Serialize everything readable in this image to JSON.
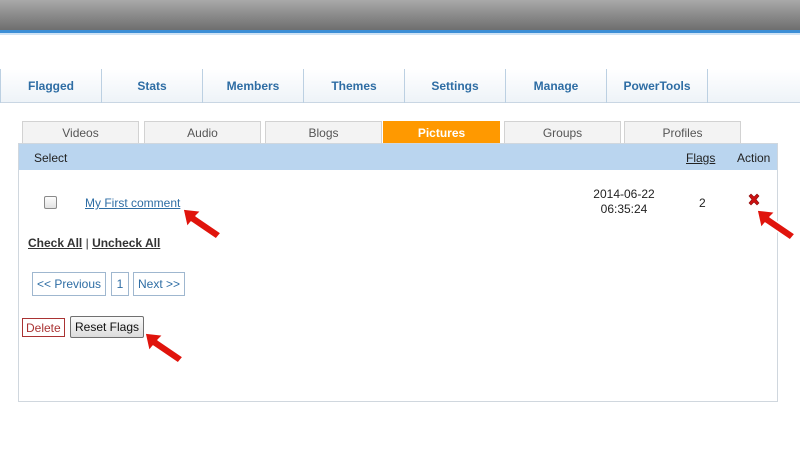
{
  "main_nav": [
    {
      "label": "Flagged"
    },
    {
      "label": "Stats"
    },
    {
      "label": "Members"
    },
    {
      "label": "Themes"
    },
    {
      "label": "Settings"
    },
    {
      "label": "Manage"
    },
    {
      "label": "PowerTools"
    }
  ],
  "sub_tabs": [
    {
      "label": "Videos",
      "active": false
    },
    {
      "label": "Audio",
      "active": false
    },
    {
      "label": "Blogs",
      "active": false
    },
    {
      "label": "Pictures",
      "active": true
    },
    {
      "label": "Groups",
      "active": false
    },
    {
      "label": "Profiles",
      "active": false
    }
  ],
  "table": {
    "columns": {
      "select": "Select",
      "flags": "Flags",
      "action": "Action"
    },
    "rows": [
      {
        "title": "My First comment",
        "date": "2014-06-22",
        "time": "06:35:24",
        "flags": "2",
        "action_icon": "delete-x-icon"
      }
    ]
  },
  "bulk": {
    "check_all": "Check All",
    "separator": "|",
    "uncheck_all": "Uncheck All"
  },
  "pager": {
    "previous": "<< Previous",
    "page": "1",
    "next": "Next >>"
  },
  "buttons": {
    "delete": "Delete",
    "reset_flags": "Reset Flags"
  },
  "colors": {
    "accent_tab": "#ff9900",
    "link": "#2e6da4",
    "table_header": "#bad5ef",
    "annotation_arrow": "#e0140c",
    "delete_x": "#cc1111"
  }
}
